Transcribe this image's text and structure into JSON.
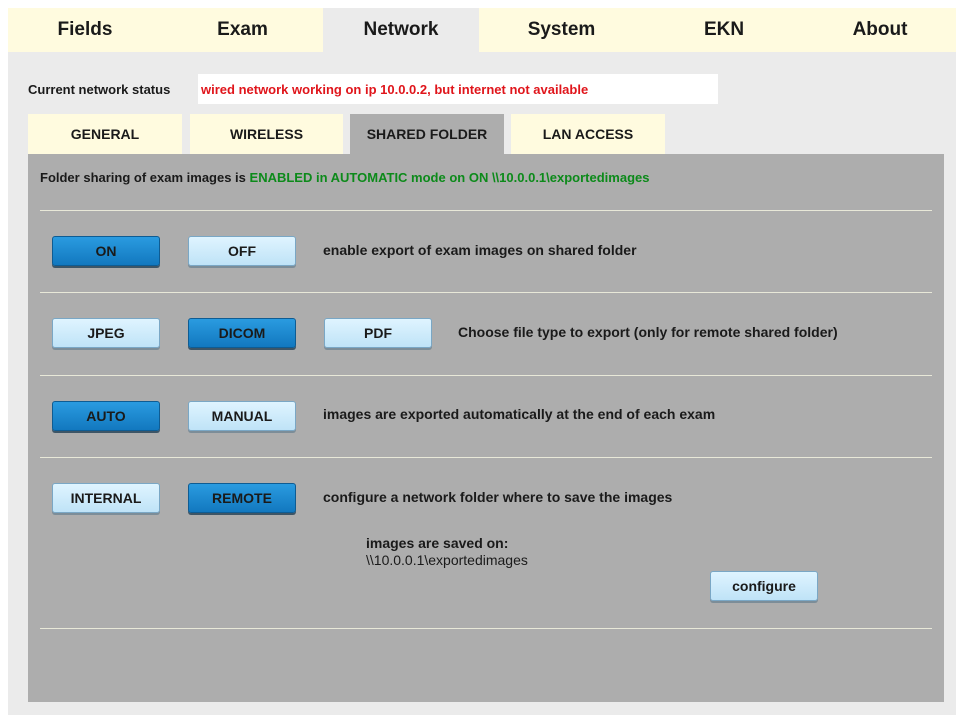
{
  "top_tabs": [
    {
      "label": "Fields",
      "active": false
    },
    {
      "label": "Exam",
      "active": false
    },
    {
      "label": "Network",
      "active": true
    },
    {
      "label": "System",
      "active": false
    },
    {
      "label": "EKN",
      "active": false
    },
    {
      "label": "About",
      "active": false
    }
  ],
  "status": {
    "label": "Current network status",
    "value": "wired network working on ip 10.0.0.2, but internet not available",
    "value_color": "#e0151b"
  },
  "sub_tabs": [
    {
      "label": "GENERAL",
      "active": false
    },
    {
      "label": "WIRELESS",
      "active": false
    },
    {
      "label": "SHARED FOLDER",
      "active": true
    },
    {
      "label": "LAN ACCESS",
      "active": false
    }
  ],
  "sharing": {
    "prefix": "Folder sharing of exam images is",
    "state": "ENABLED in AUTOMATIC mode on ON \\\\10.0.0.1\\exportedimages",
    "state_color": "#0c8a1a"
  },
  "rows": {
    "enable": {
      "buttons": [
        {
          "label": "ON",
          "selected": true
        },
        {
          "label": "OFF",
          "selected": false
        }
      ],
      "description": "enable export of exam images on shared folder"
    },
    "filetype": {
      "buttons": [
        {
          "label": "JPEG",
          "selected": false
        },
        {
          "label": "DICOM",
          "selected": true
        },
        {
          "label": "PDF",
          "selected": false
        }
      ],
      "description": "Choose file type to export (only for remote shared folder)"
    },
    "mode": {
      "buttons": [
        {
          "label": "AUTO",
          "selected": true
        },
        {
          "label": "MANUAL",
          "selected": false
        }
      ],
      "description": "images are exported automatically at the end of each exam"
    },
    "location": {
      "buttons": [
        {
          "label": "INTERNAL",
          "selected": false
        },
        {
          "label": "REMOTE",
          "selected": true
        }
      ],
      "description": "configure a network folder where to save the images"
    }
  },
  "saved": {
    "label": "images are saved on:",
    "path": "\\\\10.0.0.1\\exportedimages",
    "configure_label": "configure"
  },
  "colors": {
    "tab_bg": "#fffbdf",
    "panel_bg": "#adadad",
    "button_selected": "#1a8ad4",
    "button_unselected": "#d4eefc"
  }
}
